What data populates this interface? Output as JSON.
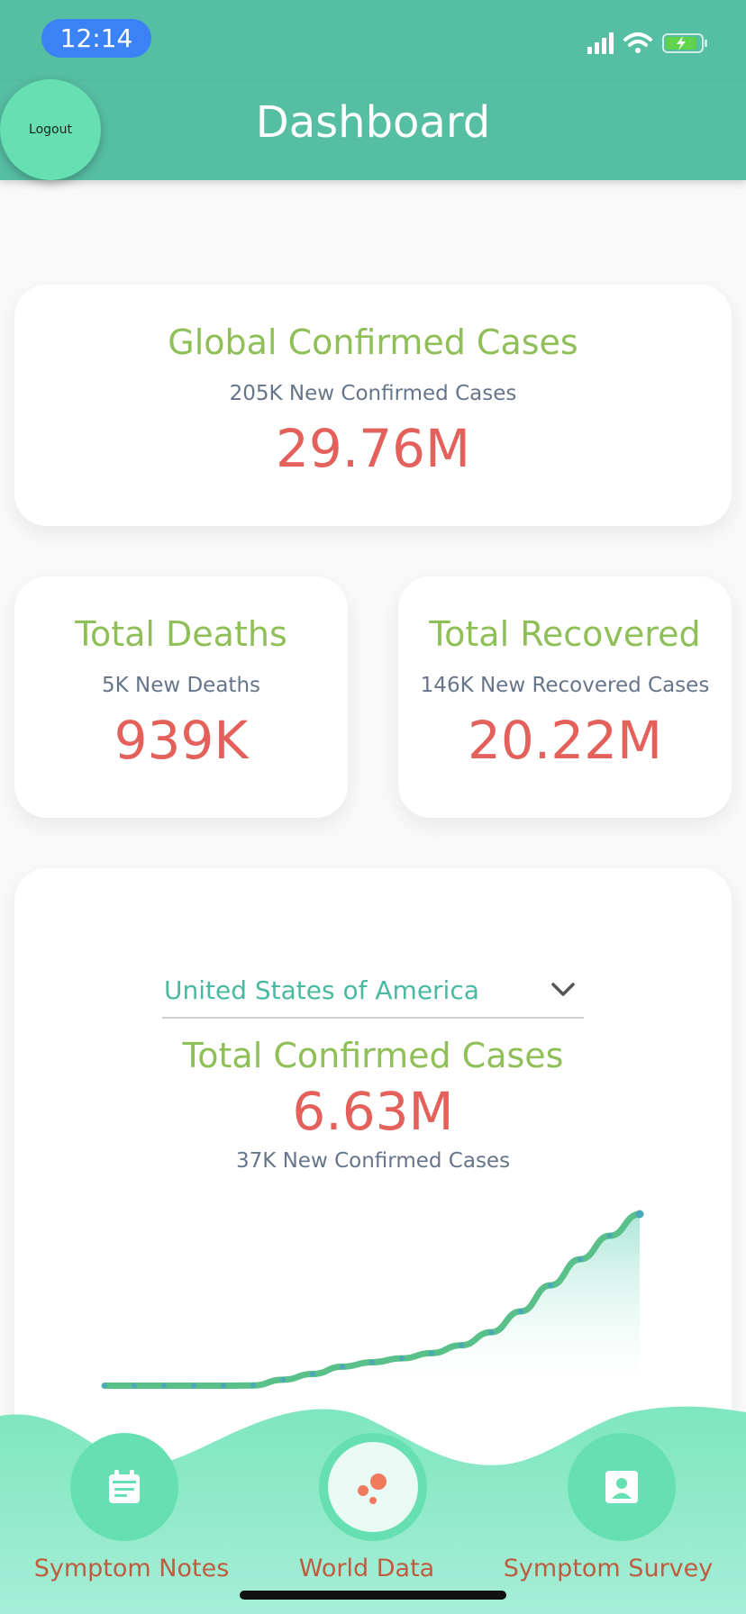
{
  "status_bar": {
    "time": "12:14"
  },
  "app_bar": {
    "title": "Dashboard",
    "logout_label": "Logout"
  },
  "global_card": {
    "title": "Global Confirmed Cases",
    "subtitle": "205K New Confirmed Cases",
    "value": "29.76M"
  },
  "deaths_card": {
    "title": "Total Deaths",
    "subtitle": "5K New Deaths",
    "value": "939K"
  },
  "recovered_card": {
    "title": "Total Recovered",
    "subtitle": "146K New Recovered Cases",
    "value": "20.22M"
  },
  "country_card": {
    "country_select": "United States of America",
    "title": "Total Confirmed Cases",
    "value": "6.63M",
    "subtitle": "37K New Confirmed Cases"
  },
  "chart_data": {
    "type": "area",
    "x": [
      1,
      2,
      3,
      4,
      5,
      6,
      7,
      8,
      9,
      10,
      11,
      12,
      13,
      14,
      15,
      16,
      17,
      18,
      19
    ],
    "values": [
      0.05,
      0.05,
      0.05,
      0.05,
      0.05,
      0.06,
      0.28,
      0.5,
      0.78,
      0.95,
      1.1,
      1.3,
      1.6,
      2.1,
      2.9,
      3.9,
      4.9,
      5.8,
      6.63
    ],
    "ylim": [
      0,
      6.63
    ],
    "title": "",
    "xlabel": "",
    "ylabel": "",
    "line_color": "#59c089",
    "dot_color": "#4aa8b8",
    "fill_color": "#a9e6d6"
  },
  "bottom_nav": {
    "items": [
      {
        "label": "Symptom Notes",
        "icon": "calendar-icon"
      },
      {
        "label": "World Data",
        "icon": "bubbles-icon"
      },
      {
        "label": "Symptom Survey",
        "icon": "contact-card-icon"
      }
    ]
  },
  "colors": {
    "primary": "#56bea3",
    "accent": "#66e0b2",
    "title_green": "#8fbf57",
    "number_red": "#e4605b",
    "nav_label": "#bd5d3f"
  }
}
